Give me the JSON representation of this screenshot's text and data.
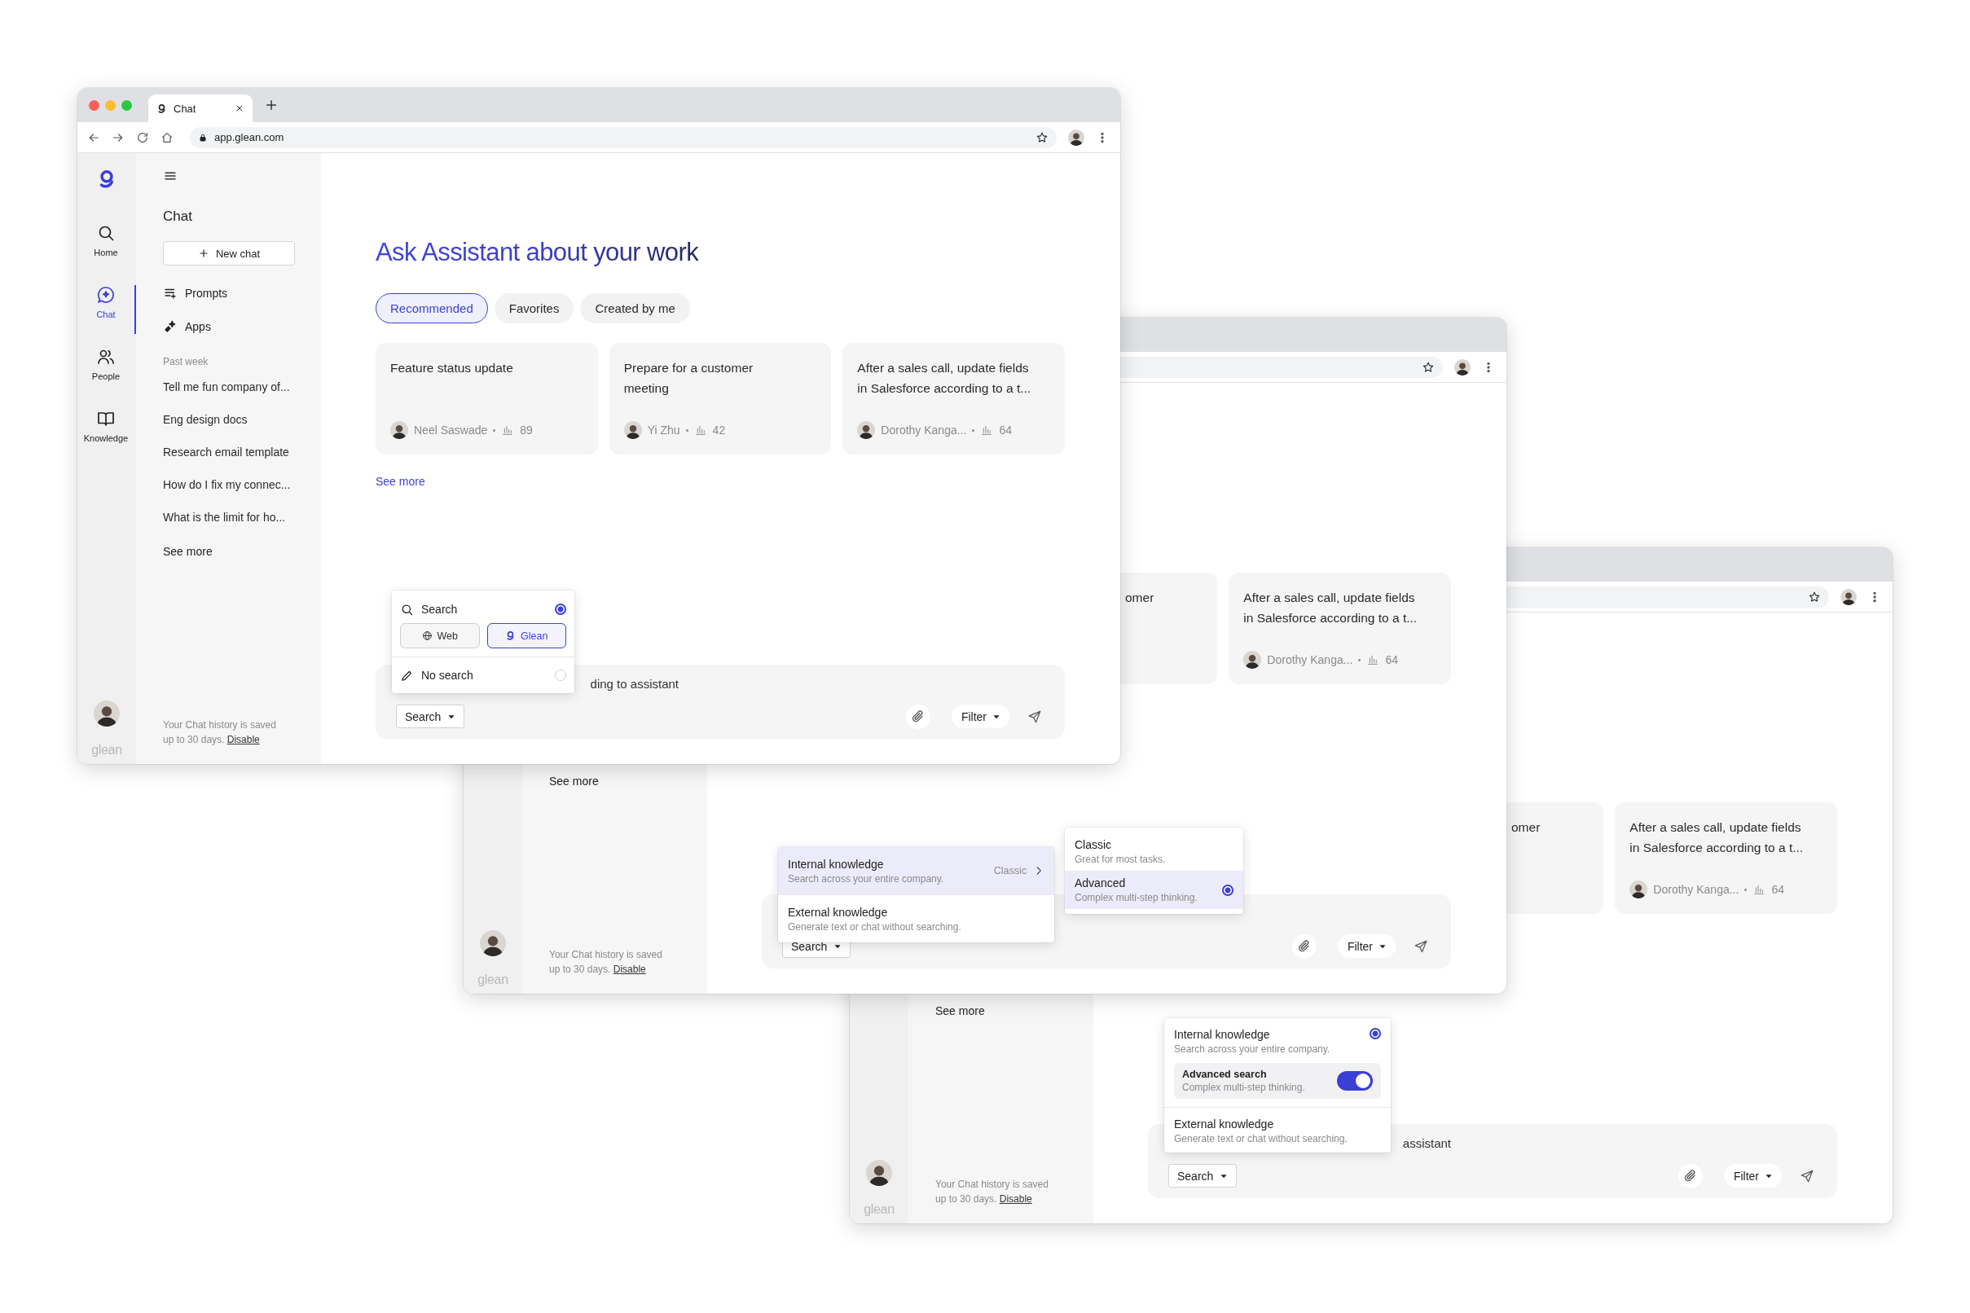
{
  "windows": [
    {
      "tab": {
        "title": "Chat"
      },
      "url": "app.glean.com",
      "rail": {
        "items": [
          {
            "label": "Home",
            "kind": "search",
            "selected": false
          },
          {
            "label": "Chat",
            "kind": "chat",
            "selected": true
          },
          {
            "label": "People",
            "kind": "people",
            "selected": false
          },
          {
            "label": "Knowledge",
            "kind": "knowledge",
            "selected": false
          }
        ],
        "logo_text": "glean"
      },
      "sidebar": {
        "title": "Chat",
        "new_chat": "New chat",
        "links": [
          {
            "label": "Prompts",
            "kind": "prompts"
          },
          {
            "label": "Apps",
            "kind": "apps"
          }
        ],
        "section": "Past week",
        "history": [
          "Tell me fun company of...",
          "Eng design docs",
          "Research email template",
          "How do I fix my connec...",
          "What is the limit for ho..."
        ],
        "see_more": "See more",
        "note": "Your Chat history is saved up to 30 days.",
        "note_link": "Disable"
      },
      "main": {
        "heading": "Ask Assistant about your work",
        "tabs": [
          {
            "label": "Recommended",
            "selected": true
          },
          {
            "label": "Favorites",
            "selected": false
          },
          {
            "label": "Created by me",
            "selected": false
          }
        ],
        "cards": [
          {
            "kind": "full",
            "title": "Feature status update",
            "author": "Neel Saswade",
            "count": "89"
          },
          {
            "kind": "full",
            "title": "Prepare for a customer meeting",
            "author": "Yi Zhu",
            "count": "42"
          },
          {
            "kind": "full",
            "title": "After a sales call, update fields in Salesforce according to a t...",
            "author": "Dorothy Kanga...",
            "count": "64"
          }
        ],
        "see_more": "See more"
      },
      "composer": {
        "placeholder": "ding to assistant",
        "mode_button": "Search",
        "filter": "Filter",
        "menu": {
          "kind": "search_mode",
          "options": [
            {
              "kind": "search",
              "label": "Search",
              "selected": true,
              "sources": [
                {
                  "kind": "web",
                  "label": "Web",
                  "selected": false
                },
                {
                  "kind": "glean",
                  "label": "Glean",
                  "selected": true
                }
              ]
            },
            {
              "kind": "none",
              "label": "No search",
              "selected": false
            }
          ]
        }
      }
    },
    {
      "rail": {
        "logo_text": "glean"
      },
      "sidebar": {
        "see_more": "See more",
        "note": "Your Chat history is saved up to 30 days.",
        "note_link": "Disable"
      },
      "main": {
        "cards": [
          {
            "kind": "clipped",
            "title": "omer"
          },
          {
            "kind": "full",
            "title": "After a sales call, update fields in Salesforce according to a t...",
            "author": "Dorothy Kanga...",
            "count": "64"
          }
        ]
      },
      "composer": {
        "mode_button": "Search",
        "filter": "Filter",
        "menu": {
          "kind": "knowledge_submenu",
          "items": [
            {
              "title": "Internal knowledge",
              "description": "Search across your entire company.",
              "value": "Classic",
              "expanded": true
            },
            {
              "title": "External knowledge",
              "description": "Generate text or chat without searching.",
              "expanded": false
            }
          ],
          "submenu": [
            {
              "title": "Classic",
              "description": "Great for most tasks.",
              "selected": false
            },
            {
              "title": "Advanced",
              "description": "Complex multi-step thinking.",
              "selected": true
            }
          ]
        }
      }
    },
    {
      "rail": {
        "logo_text": "glean"
      },
      "sidebar": {
        "see_more": "See more",
        "note": "Your Chat history is saved up to 30 days.",
        "note_link": "Disable"
      },
      "main": {
        "cards": [
          {
            "kind": "clipped",
            "title": "omer"
          },
          {
            "kind": "full",
            "title": "After a sales call, update fields in Salesforce according to a t...",
            "author": "Dorothy Kanga...",
            "count": "64"
          }
        ]
      },
      "composer": {
        "placeholder": "assistant",
        "mode_button": "Search",
        "filter": "Filter",
        "menu": {
          "kind": "knowledge_toggle",
          "items": [
            {
              "title": "Internal knowledge",
              "description": "Search across your entire company.",
              "selected": true,
              "setting": {
                "title": "Advanced search",
                "description": "Complex multi-step thinking.",
                "on": true
              }
            },
            {
              "title": "External knowledge",
              "description": "Generate text or chat without searching.",
              "selected": false
            }
          ]
        }
      }
    }
  ]
}
